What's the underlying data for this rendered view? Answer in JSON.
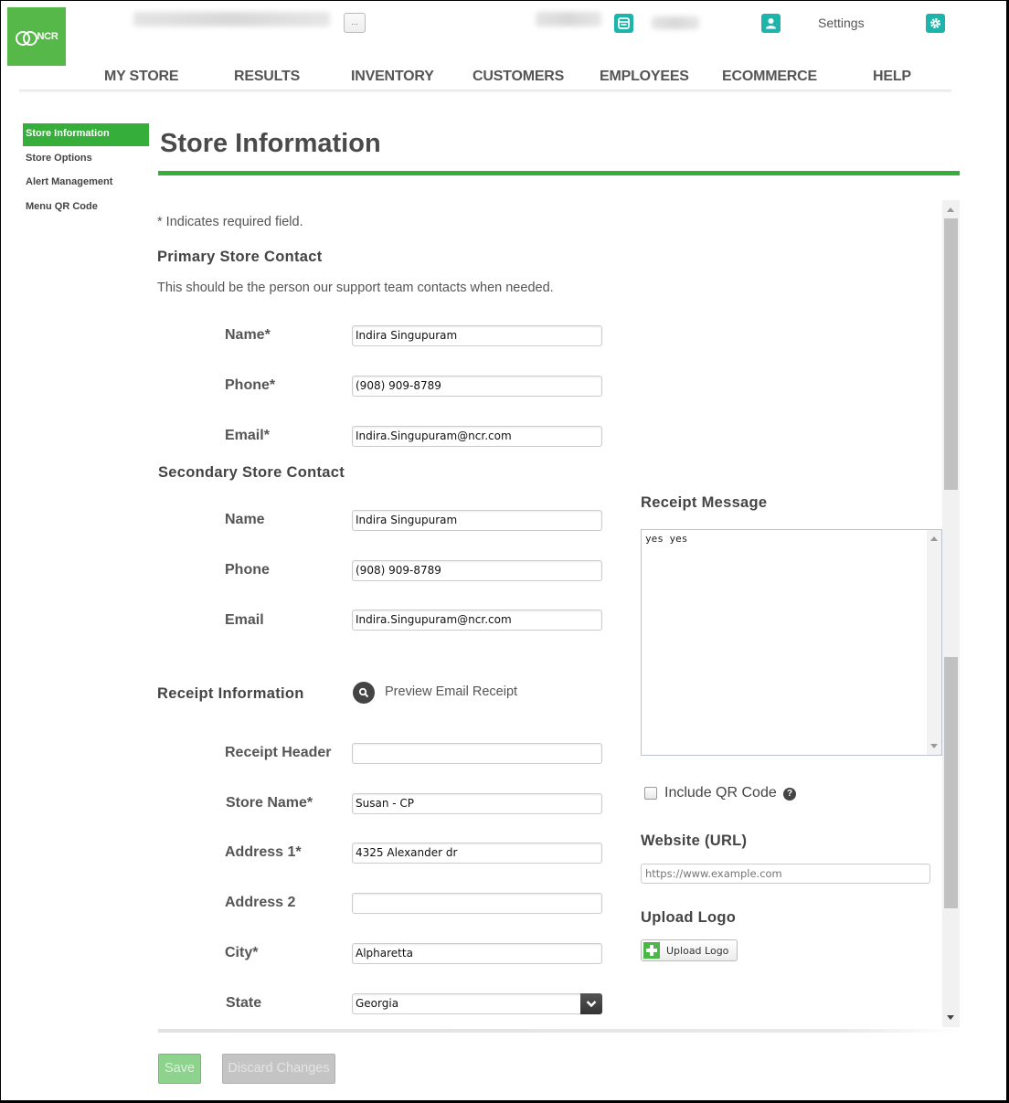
{
  "header": {
    "logo_text": "NCR",
    "settings_label": "Settings",
    "more_button_label": "...",
    "colors": {
      "brand_green": "#55b848",
      "accent_teal": "#1db5ab",
      "active_green": "#35ae3a"
    }
  },
  "nav": {
    "items": [
      {
        "label": "MY STORE"
      },
      {
        "label": "RESULTS"
      },
      {
        "label": "INVENTORY"
      },
      {
        "label": "CUSTOMERS"
      },
      {
        "label": "EMPLOYEES"
      },
      {
        "label": "ECOMMERCE"
      },
      {
        "label": "HELP"
      }
    ]
  },
  "sidebar": {
    "items": [
      {
        "label": "Store Information",
        "active": true
      },
      {
        "label": "Store Options",
        "active": false
      },
      {
        "label": "Alert Management",
        "active": false
      },
      {
        "label": "Menu QR Code",
        "active": false
      }
    ]
  },
  "page": {
    "title": "Store Information",
    "required_note": "* Indicates required field."
  },
  "primary_contact": {
    "heading": "Primary Store Contact",
    "description": "This should be the person our support team contacts when needed.",
    "fields": [
      {
        "label": "Name*",
        "value": "Indira Singupuram"
      },
      {
        "label": "Phone*",
        "value": "(908) 909-8789"
      },
      {
        "label": "Email*",
        "value": "Indira.Singupuram@ncr.com"
      }
    ]
  },
  "secondary_contact": {
    "heading": "Secondary Store Contact",
    "fields": [
      {
        "label": "Name",
        "value": "Indira Singupuram"
      },
      {
        "label": "Phone",
        "value": "(908) 909-8789"
      },
      {
        "label": "Email",
        "value": "Indira.Singupuram@ncr.com"
      }
    ]
  },
  "receipt_info": {
    "heading": "Receipt Information",
    "preview_label": "Preview Email Receipt",
    "fields": [
      {
        "label": "Receipt Header",
        "value": ""
      },
      {
        "label": "Store Name*",
        "value": "Susan - CP"
      },
      {
        "label": "Address 1*",
        "value": "4325 Alexander dr"
      },
      {
        "label": "Address 2",
        "value": ""
      },
      {
        "label": "City*",
        "value": "Alpharetta"
      },
      {
        "label": "State",
        "value": "Georgia"
      }
    ]
  },
  "receipt_message": {
    "heading": "Receipt Message",
    "value": "yes yes"
  },
  "qr": {
    "label": "Include QR Code",
    "checked": false,
    "help_glyph": "?"
  },
  "website": {
    "heading": "Website (URL)",
    "value": "",
    "placeholder": "https://www.example.com"
  },
  "upload": {
    "heading": "Upload Logo",
    "button_label": "Upload Logo"
  },
  "actions": {
    "save_label": "Save",
    "discard_label": "Discard Changes"
  }
}
